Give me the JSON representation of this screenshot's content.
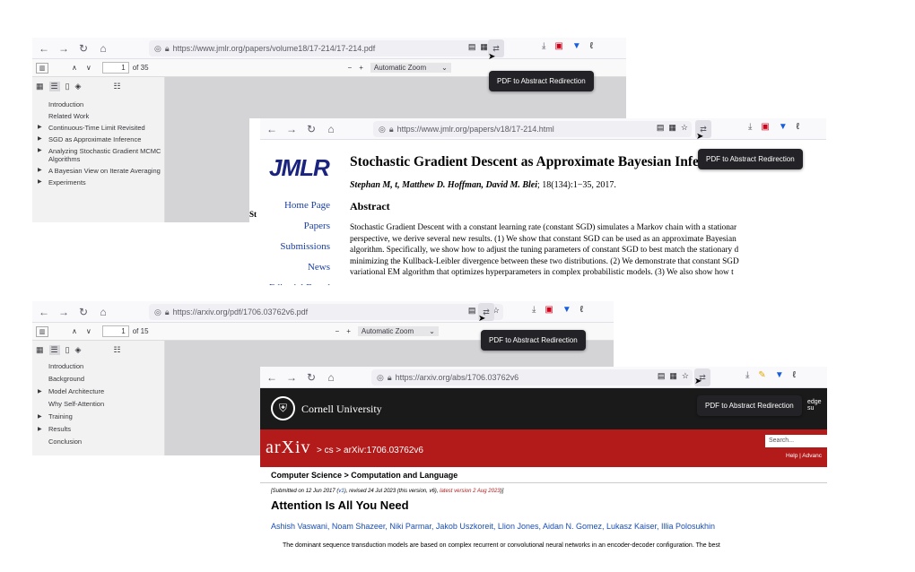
{
  "tooltip_label": "PDF to Abstract Redirection",
  "jmlr_pdf": {
    "url_host": "https://www.jmlr.org",
    "url_path": "/papers/volume18/17-214/17-214.pdf",
    "page": "1",
    "of_pages": "of 35",
    "zoom": "Automatic Zoom",
    "outline": [
      "Introduction",
      "Related Work",
      "Continuous-Time Limit Revisited",
      "SGD as Approximate Inference",
      "Analyzing Stochastic Gradient MCMC Algorithms",
      "A Bayesian View on Iterate Averaging",
      "Experiments"
    ]
  },
  "jmlr_abs": {
    "url_host": "https://www.jmlr.org",
    "url_path": "/papers/v18/17-214.html",
    "logo": "JMLR",
    "nav": [
      "Home Page",
      "Papers",
      "Submissions",
      "News",
      "Editorial Board"
    ],
    "title": "Stochastic Gradient Descent as Approximate Bayesian Inference",
    "authors": "Stephan M, t, Matthew D. Hoffman, David M. Blei",
    "citation": "; 18(134):1−35, 2017.",
    "abstract_heading": "Abstract",
    "abstract_lines": [
      "Stochastic Gradient Descent with a constant learning rate (constant SGD) simulates a Markov chain with a stationar",
      "perspective, we derive several new results. (1) We show that constant SGD can be used as an approximate Bayesian",
      "algorithm. Specifically, we show how to adjust the tuning parameters of constant SGD to best match the stationary d",
      "minimizing the Kullback-Leibler divergence between these two distributions. (2) We demonstrate that constant SGD",
      "variational EM algorithm that optimizes hyperparameters in complex probabilistic models. (3) We also show how t"
    ]
  },
  "arxiv_pdf": {
    "url_host": "https://arxiv.org",
    "url_path": "/pdf/1706.03762v6.pdf",
    "page": "1",
    "of_pages": "of 15",
    "zoom": "Automatic Zoom",
    "outline": [
      "Introduction",
      "Background",
      "Model Architecture",
      "Why Self-Attention",
      "Training",
      "Results",
      "Conclusion"
    ],
    "outline_expandable": [
      false,
      false,
      true,
      false,
      true,
      true,
      false
    ]
  },
  "arxiv_abs": {
    "url_host": "https://arxiv.org",
    "url_path": "/abs/1706.03762v6",
    "cornell": "Cornell University",
    "brand": "arXiv",
    "crumb": "> cs > arXiv:1706.03762v6",
    "search_placeholder": "Search...",
    "help": "Help | Advanc",
    "edge": "edge su",
    "subject": "Computer Science > Computation and Language",
    "submitted_prefix": "[Submitted on 12 Jun 2017 (",
    "submitted_v1": "v1",
    "submitted_mid": "), revised 24 Jul 2023 (this version, v6), ",
    "submitted_latest": "latest version 2 Aug 2023",
    "submitted_v7": "v7",
    "submitted_end": ")]",
    "title": "Attention Is All You Need",
    "authors": "Ashish Vaswani, Noam Shazeer, Niki Parmar, Jakob Uszkoreit, Llion Jones, Aidan N. Gomez, Lukasz Kaiser, Illia Polosukhin",
    "abstract": "The dominant sequence transduction models are based on complex recurrent or convolutional neural networks in an encoder-decoder configuration. The best",
    "red": "#b31b1b"
  }
}
